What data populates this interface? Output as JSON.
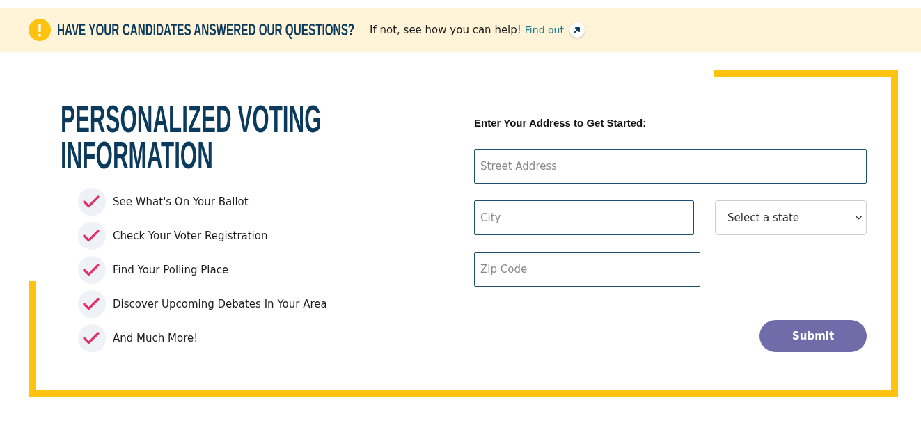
{
  "banner": {
    "title": "HAVE YOUR CANDIDATES ANSWERED OUR QUESTIONS?",
    "text": "If not, see how you can help!",
    "link": "Find out"
  },
  "hero": {
    "heading": "PERSONALIZED VOTING INFORMATION",
    "features": [
      "See What's On Your Ballot",
      "Check Your Voter Registration",
      "Find Your Polling Place",
      "Discover Upcoming Debates In Your Area",
      "And Much More!"
    ]
  },
  "form": {
    "label": "Enter Your Address to Get Started:",
    "rows": [
      [
        {
          "kind": "text",
          "placeholder": "Street Address"
        }
      ],
      [
        {
          "kind": "text",
          "placeholder": "City"
        },
        {
          "kind": "select",
          "value": "Select a state"
        }
      ],
      [
        {
          "kind": "text",
          "placeholder": "Zip Code"
        }
      ]
    ],
    "submit": "Submit"
  }
}
